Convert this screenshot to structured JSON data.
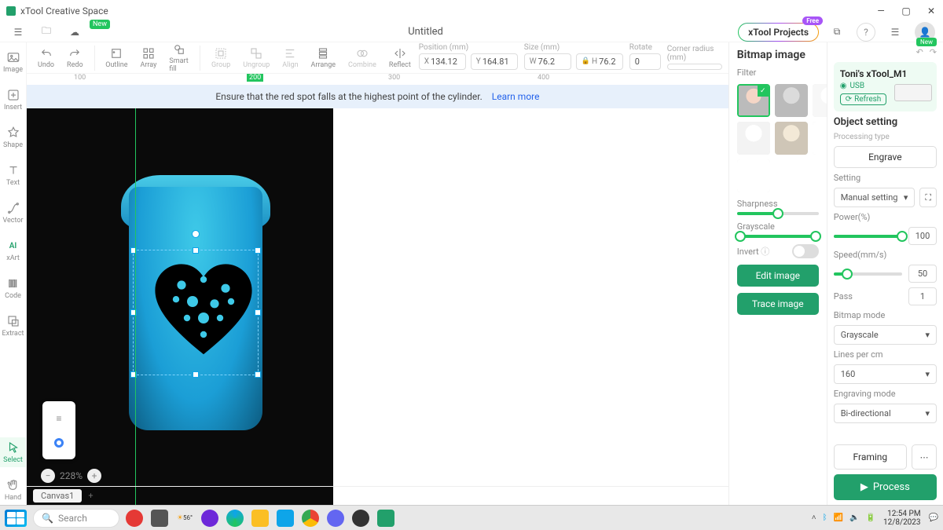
{
  "app": {
    "title": "xTool Creative Space"
  },
  "window": {
    "minimize": "—",
    "maximize": "▢",
    "close": "✕"
  },
  "menubar": {
    "doc_title": "Untitled",
    "projects_btn": "xTool Projects",
    "badge_free": "Free",
    "badge_new": "New"
  },
  "left_rail": [
    {
      "label": "Image"
    },
    {
      "label": "Insert"
    },
    {
      "label": "Shape"
    },
    {
      "label": "Text"
    },
    {
      "label": "Vector"
    },
    {
      "label": "xArt"
    },
    {
      "label": "Code"
    },
    {
      "label": "Extract"
    },
    {
      "label": "Select"
    },
    {
      "label": "Hand"
    }
  ],
  "toolbar": {
    "undo": "Undo",
    "redo": "Redo",
    "outline": "Outline",
    "array": "Array",
    "smartfill": "Smart fill",
    "group": "Group",
    "ungroup": "Ungroup",
    "align": "Align",
    "arrange": "Arrange",
    "combine": "Combine",
    "reflect": "Reflect"
  },
  "props": {
    "position_label": "Position (mm)",
    "x_prefix": "X",
    "x_val": "134.12",
    "y_prefix": "Y",
    "y_val": "164.81",
    "size_label": "Size (mm)",
    "w_prefix": "W",
    "w_val": "76.2",
    "h_prefix": "H",
    "h_val": "76.2",
    "rotate_label": "Rotate",
    "rotate_val": "0",
    "corner_label": "Corner radius (mm)",
    "corner_val": ""
  },
  "banner": {
    "text": "Ensure that the red spot falls at the highest point of the cylinder.",
    "link": "Learn more"
  },
  "ruler": {
    "m100": "100",
    "m200": "200",
    "m300": "300",
    "m400": "400"
  },
  "zoom": {
    "value": "228%"
  },
  "tabs": {
    "canvas1": "Canvas1",
    "add": "+"
  },
  "bitmap": {
    "title": "Bitmap image",
    "filter": "Filter",
    "sharpness": "Sharpness",
    "grayscale": "Grayscale",
    "invert": "Invert",
    "edit_btn": "Edit image",
    "trace_btn": "Trace image"
  },
  "device": {
    "name": "Toni's xTool_M1",
    "conn": "USB",
    "refresh": "Refresh",
    "badge_new": "New"
  },
  "object": {
    "title": "Object setting",
    "proc_type": "Processing type",
    "engrave": "Engrave",
    "setting": "Setting",
    "manual": "Manual setting",
    "power_label": "Power(%)",
    "power_val": "100",
    "speed_label": "Speed(mm/s)",
    "speed_val": "50",
    "pass_label": "Pass",
    "pass_val": "1",
    "bitmap_mode_label": "Bitmap mode",
    "bitmap_mode": "Grayscale",
    "lines_label": "Lines per cm",
    "lines_val": "160",
    "engraving_mode_label": "Engraving mode",
    "engraving_mode": "Bi-directional",
    "framing": "Framing",
    "process": "Process"
  },
  "taskbar": {
    "search": "Search",
    "temp": "56°",
    "time": "12:54 PM",
    "date": "12/8/2023"
  }
}
